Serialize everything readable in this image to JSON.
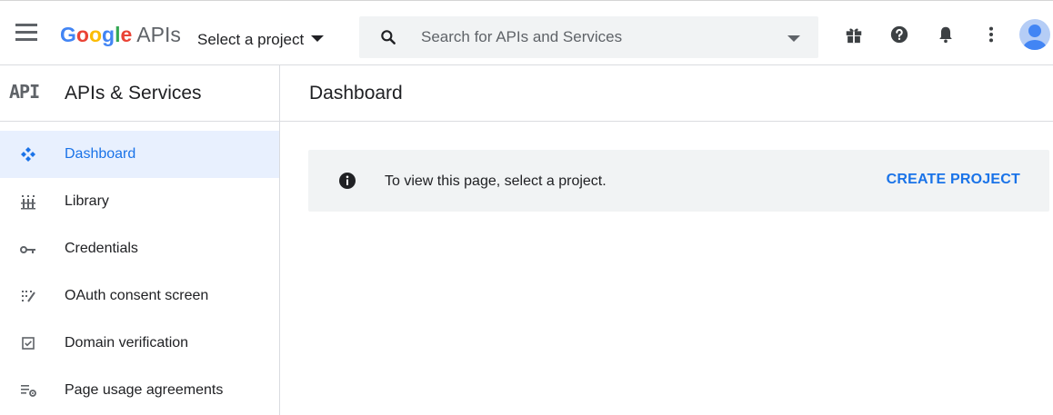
{
  "topbar": {
    "logo_word": "Google",
    "logo_product": "APIs",
    "project_select_label": "Select a project",
    "search_placeholder": "Search for APIs and Services",
    "icons": [
      "menu-icon",
      "search-icon",
      "dropdown-caret-icon",
      "gift-icon",
      "help-icon",
      "notifications-icon",
      "more-vert-icon",
      "avatar"
    ]
  },
  "sidebar": {
    "badge": "API",
    "title": "APIs & Services",
    "items": [
      {
        "label": "Dashboard",
        "icon": "dashboard-icon",
        "active": true
      },
      {
        "label": "Library",
        "icon": "library-icon",
        "active": false
      },
      {
        "label": "Credentials",
        "icon": "key-icon",
        "active": false
      },
      {
        "label": "OAuth consent screen",
        "icon": "consent-icon",
        "active": false
      },
      {
        "label": "Domain verification",
        "icon": "checkbox-icon",
        "active": false
      },
      {
        "label": "Page usage agreements",
        "icon": "list-settings-icon",
        "active": false
      }
    ]
  },
  "main": {
    "title": "Dashboard",
    "banner": {
      "message": "To view this page, select a project.",
      "action_label": "CREATE PROJECT"
    }
  },
  "colors": {
    "accent": "#1a73e8",
    "active_bg": "#e8f0fe",
    "banner_bg": "#f1f3f4",
    "icon_gray": "#5f6368",
    "google_blue": "#4285f4",
    "google_red": "#ea4335",
    "google_yellow": "#fbbc05",
    "google_green": "#34a853"
  }
}
